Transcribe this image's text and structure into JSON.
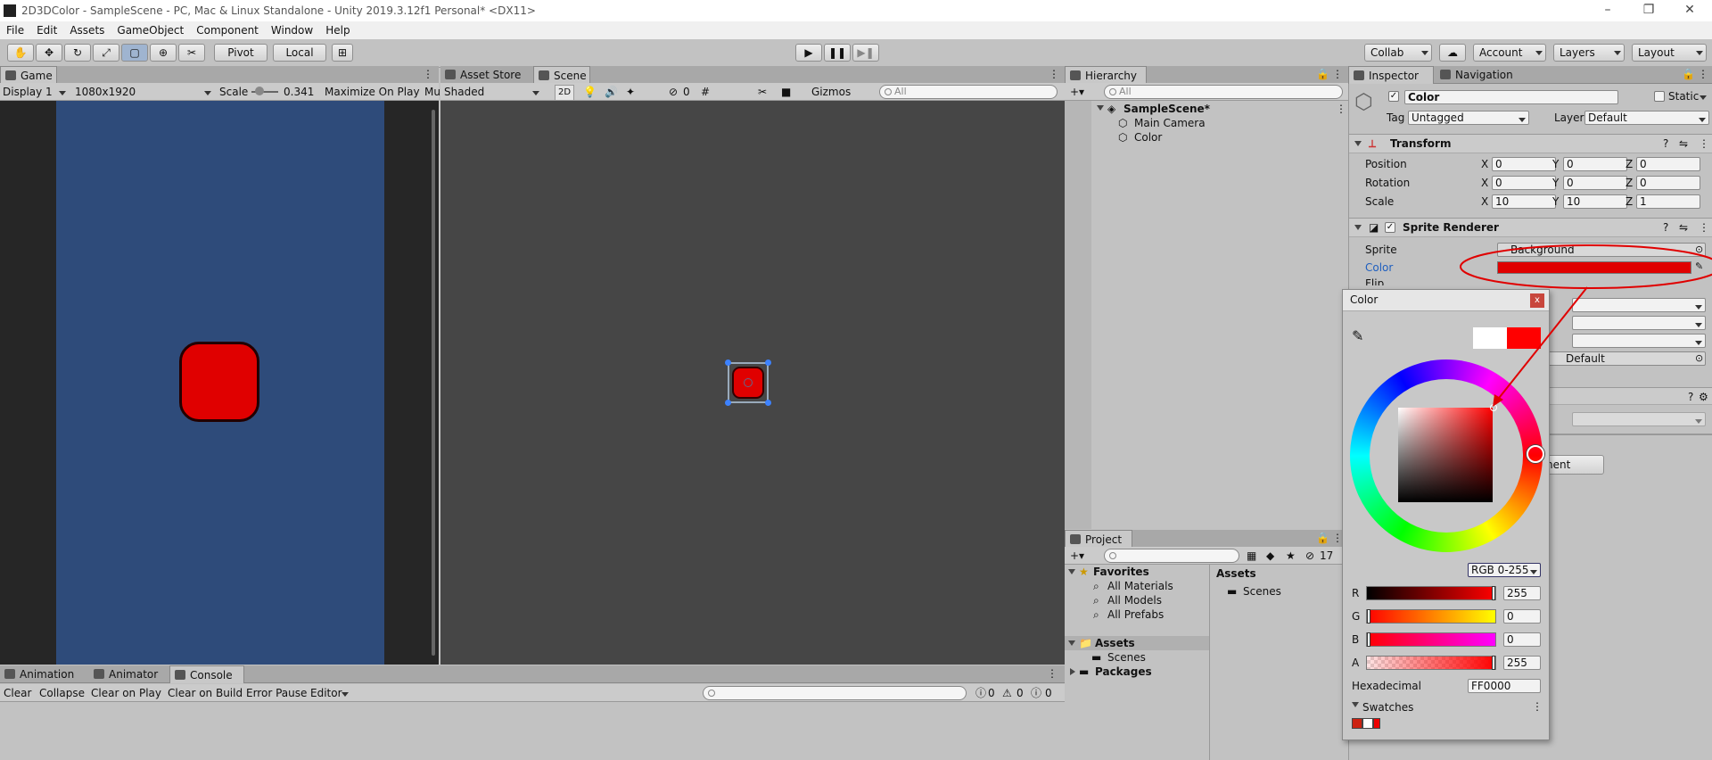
{
  "window": {
    "title": "2D3DColor - SampleScene - PC, Mac & Linux Standalone - Unity 2019.3.12f1 Personal* <DX11>"
  },
  "menu": [
    "File",
    "Edit",
    "Assets",
    "GameObject",
    "Component",
    "Window",
    "Help"
  ],
  "toolbar": {
    "pivot": "Pivot",
    "local": "Local",
    "collab": "Collab",
    "account": "Account",
    "layers": "Layers",
    "layout": "Layout"
  },
  "game": {
    "tab": "Game",
    "display": "Display 1",
    "resolution": "1080x1920",
    "scale_label": "Scale",
    "scale_value": "0.341",
    "maximize": "Maximize On Play",
    "mute": "Mu"
  },
  "scene": {
    "tab_store": "Asset Store",
    "tab": "Scene",
    "shading": "Shaded",
    "mode2d": "2D",
    "hidden_count": "0",
    "gizmos": "Gizmos",
    "search_placeholder": "All"
  },
  "hierarchy": {
    "tab": "Hierarchy",
    "search_placeholder": "All",
    "scene": "SampleScene*",
    "items": [
      "Main Camera",
      "Color"
    ]
  },
  "project": {
    "tab": "Project",
    "hidden_count": "17",
    "favorites": "Favorites",
    "fav_items": [
      "All Materials",
      "All Models",
      "All Prefabs"
    ],
    "assets": "Assets",
    "scenes": "Scenes",
    "packages": "Packages",
    "right_header": "Assets",
    "right_items": [
      "Scenes"
    ]
  },
  "console": {
    "tabs": [
      "Animation",
      "Animator",
      "Console"
    ],
    "buttons": [
      "Clear",
      "Collapse",
      "Clear on Play",
      "Clear on Build",
      "Error Pause",
      "Editor"
    ],
    "counts": [
      "0",
      "0",
      "0"
    ]
  },
  "inspector": {
    "tab": "Inspector",
    "tab_nav": "Navigation",
    "object_name": "Color",
    "static": "Static",
    "tag_label": "Tag",
    "tag": "Untagged",
    "layer_label": "Layer",
    "layer": "Default",
    "transform": "Transform",
    "position_label": "Position",
    "rotation_label": "Rotation",
    "scale_label": "Scale",
    "position": [
      "0",
      "0",
      "0"
    ],
    "rotation": [
      "0",
      "0",
      "0"
    ],
    "scale": [
      "10",
      "10",
      "1"
    ],
    "axes": [
      "X",
      "Y",
      "Z"
    ],
    "sprite_renderer": "Sprite Renderer",
    "sprite_label": "Sprite",
    "sprite": "Background",
    "color_label": "Color",
    "flip_label": "Flip",
    "material_value": "Default",
    "add_component_fragment": "nent"
  },
  "color_picker": {
    "title": "Color",
    "mode": "RGB 0-255",
    "channels": [
      {
        "label": "R",
        "value": "255"
      },
      {
        "label": "G",
        "value": "0"
      },
      {
        "label": "B",
        "value": "0"
      },
      {
        "label": "A",
        "value": "255"
      }
    ],
    "hex_label": "Hexadecimal",
    "hex": "FF0000",
    "swatches_label": "Swatches",
    "current_color": "#ff0000",
    "previous_color": "#ffffff"
  },
  "colors": {
    "game_bg": "#2e4b7a",
    "scene_bg": "#464646",
    "sprite": "#e00000",
    "annotation": "#e00000"
  }
}
